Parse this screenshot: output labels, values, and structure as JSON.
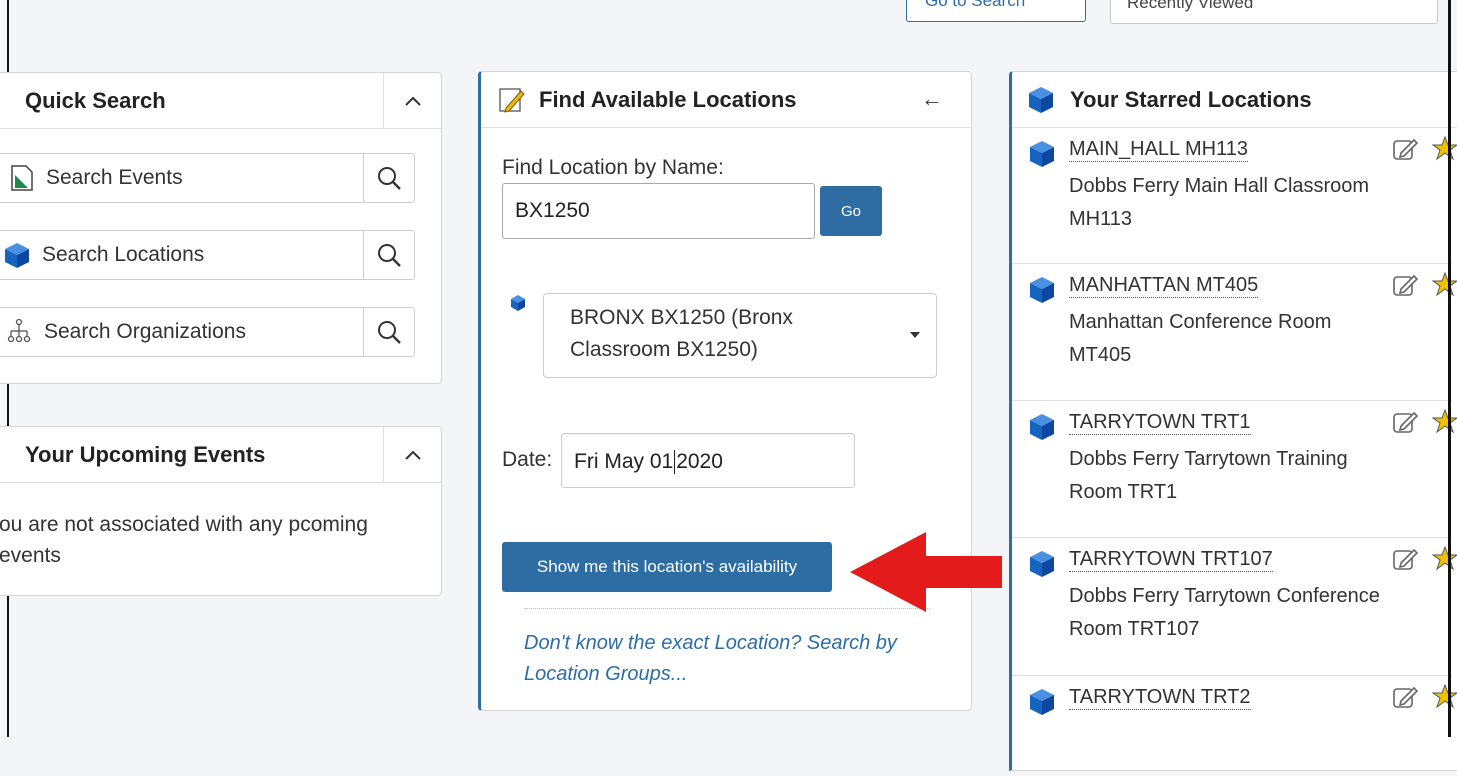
{
  "topbar": {
    "goto_search_label": "Go to Search",
    "recently_viewed_label": "Recently Viewed"
  },
  "quick_search": {
    "title": "Quick Search",
    "collapse_icon": "chevron-up-icon",
    "items": [
      {
        "label": "Search Events",
        "icon": "event-icon"
      },
      {
        "label": "Search Locations",
        "icon": "cube-icon"
      },
      {
        "label": "Search Organizations",
        "icon": "organization-icon"
      }
    ]
  },
  "upcoming_events": {
    "title": "Your Upcoming Events",
    "message": "ou are not associated with any pcoming events"
  },
  "find_locations": {
    "title": "Find Available Locations",
    "name_label": "Find Location by Name:",
    "name_value": "BX1250",
    "go_label": "Go",
    "location_line1": "BRONX BX1250 (Bronx",
    "location_line2": "Classroom BX1250)",
    "date_label": "Date:",
    "date_value_before_caret": "Fri May 01",
    "date_value_after_caret": "2020",
    "availability_button": "Show me this location's availability",
    "groups_link": "Don't know the exact Location? Search by Location Groups..."
  },
  "starred": {
    "title": "Your Starred Locations",
    "items": [
      {
        "name": "MAIN_HALL MH113",
        "description": "Dobbs Ferry Main Hall Classroom MH113"
      },
      {
        "name": "MANHATTAN MT405",
        "description": "Manhattan Conference Room MT405"
      },
      {
        "name": "TARRYTOWN TRT1",
        "description": "Dobbs Ferry Tarrytown Training Room TRT1"
      },
      {
        "name": "TARRYTOWN TRT107",
        "description": "Dobbs Ferry Tarrytown Conference Room TRT107"
      },
      {
        "name": "TARRYTOWN TRT2",
        "description": ""
      }
    ]
  },
  "colors": {
    "accent": "#2e6da4",
    "cube": "#1565c0",
    "annotation_arrow": "#e31b1b",
    "star": "#f2c200"
  }
}
